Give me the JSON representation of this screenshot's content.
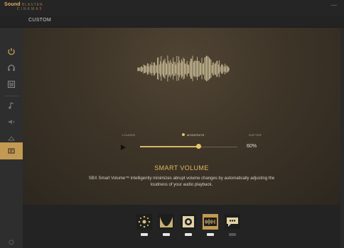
{
  "app": {
    "logo_line1_a": "Sound",
    "logo_line1_b": "BLASTER",
    "logo_line2_a": "CINEMA",
    "logo_line2_b": "3"
  },
  "page": {
    "title": "CUSTOM"
  },
  "sidebar": {
    "items": [
      {
        "icon": "power-icon"
      },
      {
        "icon": "headphones-icon"
      },
      {
        "icon": "equalizer-icon"
      },
      {
        "icon": "music-note-icon"
      },
      {
        "icon": "speaker-icon"
      },
      {
        "icon": "surround-icon"
      },
      {
        "icon": "enhance-icon"
      },
      {
        "icon": "smart-volume-icon",
        "active": true
      }
    ],
    "bottom_icon": "settings-icon"
  },
  "smart_volume": {
    "levels": [
      "Louder",
      "Moderate",
      "Softer"
    ],
    "selected_level": "Moderate",
    "slider_value": 60,
    "slider_label": "60%",
    "title": "SMART VOLUME",
    "description": "SBX Smart Volume™ intelligently minimizes abrupt volume changes by automatically adjusting the loudness of your audio playback."
  },
  "features": [
    {
      "name": "surround",
      "icon": "surround-icon",
      "enabled": true
    },
    {
      "name": "crystalizer",
      "icon": "crystalizer-icon",
      "enabled": true
    },
    {
      "name": "bass",
      "icon": "bass-icon",
      "enabled": true
    },
    {
      "name": "smart-volume",
      "icon": "smart-volume-icon",
      "enabled": true
    },
    {
      "name": "dialog-plus",
      "icon": "dialog-icon",
      "enabled": false
    }
  ],
  "colors": {
    "accent": "#c29a53",
    "title_accent": "#e4b760",
    "background": "#2b2b2b"
  }
}
